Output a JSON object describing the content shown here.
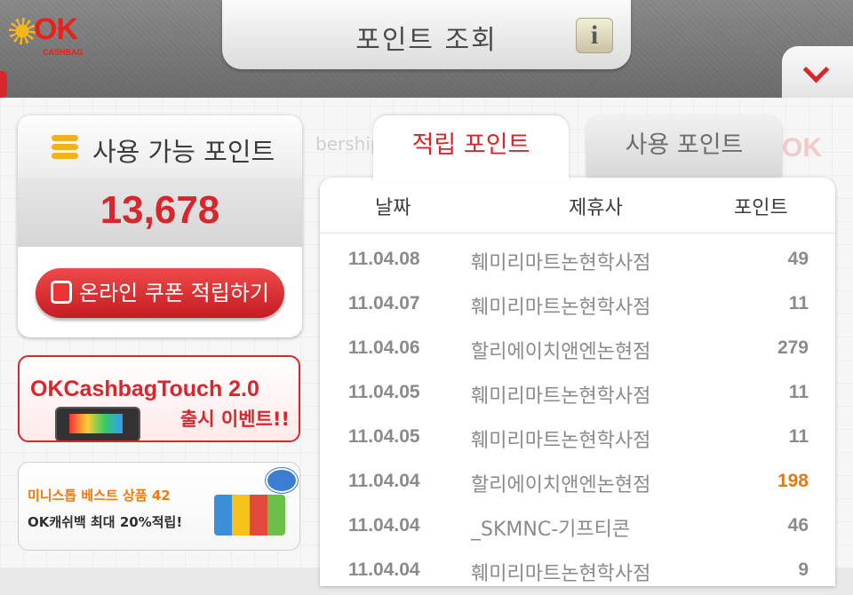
{
  "header": {
    "logo_text": "OK",
    "logo_sub": "CASHBAG",
    "title": "포인트 조회",
    "info_label": "i"
  },
  "background": {
    "ghost_text": "bership",
    "ghost_logo": "OK"
  },
  "points": {
    "label": "사용 가능 포인트",
    "value": "13,678",
    "coupon_button": "온라인 쿠폰 적립하기"
  },
  "banners": [
    {
      "title": "OKCashbagTouch 2.0",
      "subtitle": "출시 이벤트!!"
    },
    {
      "line1": "미니스톱 베스트 상품 42",
      "line2": "OK캐쉬백 최대 20%적립!"
    }
  ],
  "tabs": [
    {
      "label": "적립 포인트",
      "active": true
    },
    {
      "label": "사용 포인트",
      "active": false
    }
  ],
  "table": {
    "headers": [
      "날짜",
      "제휴사",
      "포인트"
    ],
    "rows": [
      {
        "date": "11.04.08",
        "partner": "훼미리마트논현학사점",
        "points": "49"
      },
      {
        "date": "11.04.07",
        "partner": "훼미리마트논현학사점",
        "points": "11"
      },
      {
        "date": "11.04.06",
        "partner": "할리에이치앤엔논현점",
        "points": "279"
      },
      {
        "date": "11.04.05",
        "partner": "훼미리마트논현학사점",
        "points": "11"
      },
      {
        "date": "11.04.05",
        "partner": "훼미리마트논현학사점",
        "points": "11"
      },
      {
        "date": "11.04.04",
        "partner": "할리에이치앤엔논현점",
        "points": "198"
      },
      {
        "date": "11.04.04",
        "partner": "_SKMNC-기프티콘",
        "points": "46"
      },
      {
        "date": "11.04.04",
        "partner": "훼미리마트논현학사점",
        "points": "9"
      }
    ]
  },
  "colors": {
    "accent_red": "#d8262d",
    "points_orange": "#e07a16"
  }
}
